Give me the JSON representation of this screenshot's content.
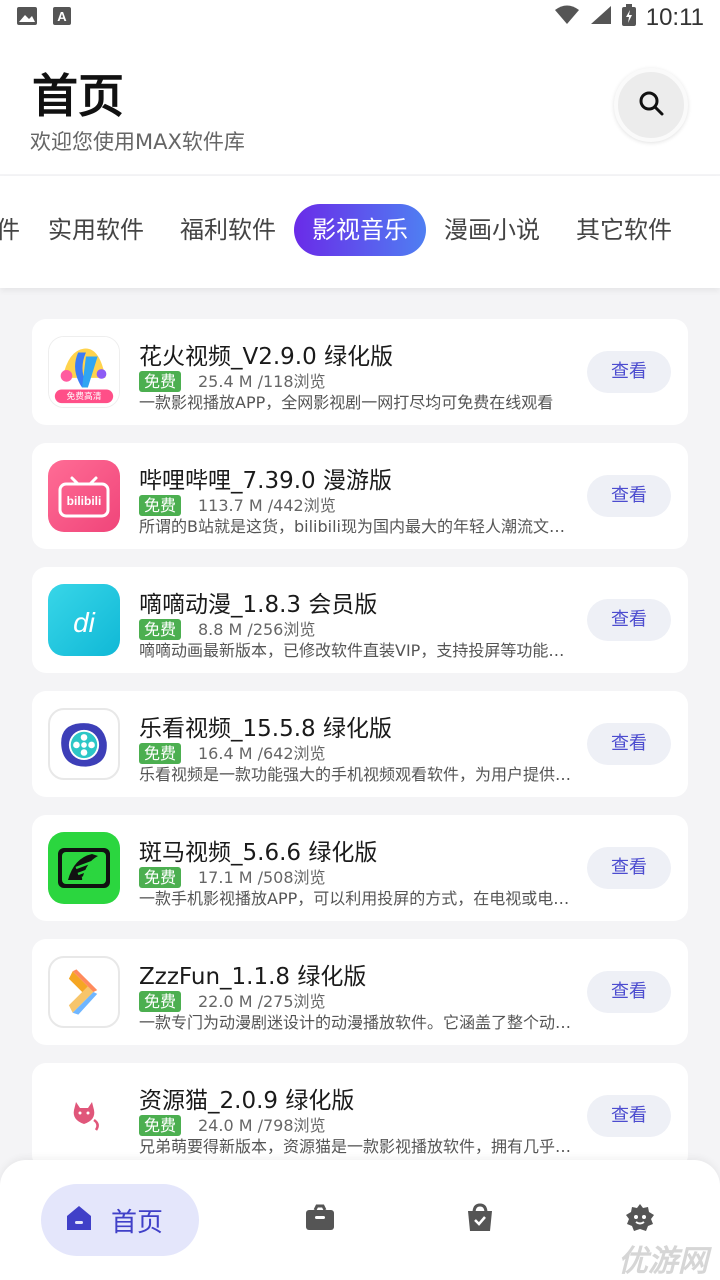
{
  "status_bar": {
    "time": "10:11"
  },
  "header": {
    "title": "首页",
    "subtitle": "欢迎您使用MAX软件库"
  },
  "tabs": [
    {
      "label": "件"
    },
    {
      "label": "实用软件"
    },
    {
      "label": "福利软件"
    },
    {
      "label": "影视音乐",
      "active": true
    },
    {
      "label": "漫画小说"
    },
    {
      "label": "其它软件"
    }
  ],
  "apps": [
    {
      "name": "花火视频_V2.9.0 绿化版",
      "badge": "免费",
      "meta": "25.4 M /118浏览",
      "desc": "一款影视播放APP，全网影视剧一网打尽均可免费在线观看",
      "button": "查看",
      "icon": "spark-video-icon",
      "icon_text": "免费高清"
    },
    {
      "name": "哔哩哔哩_7.39.0 漫游版",
      "badge": "免费",
      "meta": "113.7 M /442浏览",
      "desc": "所谓的B站就是这货，bilibili现为国内最大的年轻人潮流文化娱乐社区",
      "button": "查看",
      "icon": "bilibili-icon",
      "icon_text": "bilibili"
    },
    {
      "name": "嘀嘀动漫_1.8.3 会员版",
      "badge": "免费",
      "meta": "8.8 M /256浏览",
      "desc": "嘀嘀动画最新版本，已修改软件直装VIP，支持投屏等功能使用",
      "button": "查看",
      "icon": "didi-anime-icon",
      "icon_text": "di"
    },
    {
      "name": "乐看视频_15.5.8 绿化版",
      "badge": "免费",
      "meta": "16.4 M /642浏览",
      "desc": "乐看视频是一款功能强大的手机视频观看软件，为用户提供海量资源",
      "button": "查看",
      "icon": "film-reel-icon"
    },
    {
      "name": "斑马视频_5.6.6 绿化版",
      "badge": "免费",
      "meta": "17.1 M /508浏览",
      "desc": "一款手机影视播放APP，可以利用投屏的方式，在电视或电脑上观看",
      "button": "查看",
      "icon": "zebra-icon"
    },
    {
      "name": "ZzzFun_1.1.8 绿化版",
      "badge": "免费",
      "meta": "22.0 M /275浏览",
      "desc": "一款专门为动漫剧迷设计的动漫播放软件。它涵盖了整个动漫资源",
      "button": "查看",
      "icon": "play-arrow-icon"
    },
    {
      "name": "资源猫_2.0.9 绿化版",
      "badge": "免费",
      "meta": "24.0 M /798浏览",
      "desc": "兄弟萌要得新版本，资源猫是一款影视播放软件，拥有几乎全网资源",
      "button": "查看",
      "icon": "cat-icon"
    }
  ],
  "bottom_nav": {
    "home_label": "首页",
    "items": [
      "home-icon",
      "toolbox-icon",
      "bag-icon",
      "profile-icon"
    ]
  },
  "colors": {
    "accent": "#4040c8",
    "tab_gradient_start": "#6a2be8",
    "tab_gradient_end": "#4f7ff2",
    "badge_green": "#4caf50"
  },
  "watermark": "优游网"
}
